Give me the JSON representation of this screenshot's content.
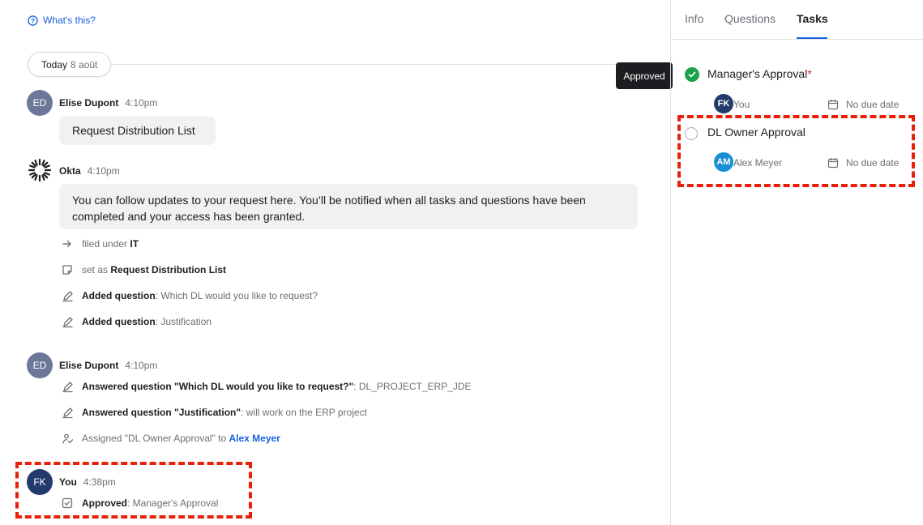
{
  "help": {
    "whats_this": "What's this?"
  },
  "timeline": {
    "day_label": "Today",
    "day_date": "8 août"
  },
  "tooltip": {
    "text": "Approved"
  },
  "messages": [
    {
      "avatar": "ED",
      "name": "Elise Dupont",
      "time": "4:10pm",
      "bubble": "Request Distribution List"
    },
    {
      "avatar": "okta-logo",
      "name": "Okta",
      "time": "4:10pm",
      "bubble": "You can follow updates to your request here. You’ll be notified when all tasks and questions have been completed and your access has been granted."
    },
    {
      "avatar": "ED",
      "name": "Elise Dupont",
      "time": "4:10pm"
    },
    {
      "avatar": "FK",
      "name": "You",
      "time": "4:38pm"
    }
  ],
  "events": {
    "filed": {
      "prefix": "filed under ",
      "value": "IT"
    },
    "set_as": {
      "prefix": "set as ",
      "value": "Request Distribution List"
    },
    "q1": {
      "bold": "Added question",
      "rest": ": Which DL would you like to request?"
    },
    "q2": {
      "bold": "Added question",
      "rest": ": Justification"
    },
    "a1": {
      "bold": "Answered question \"Which DL would you like to request?\"",
      "rest": ": DL_PROJECT_ERP_JDE"
    },
    "a2": {
      "bold": "Answered question \"Justification\"",
      "rest": ": will work on the ERP project"
    },
    "assigned": {
      "prefix": "Assigned \"DL Owner Approval\" to ",
      "link": "Alex Meyer"
    },
    "approved": {
      "bold": "Approved",
      "rest": ": Manager's Approval"
    }
  },
  "panel": {
    "tabs": [
      "Info",
      "Questions",
      "Tasks"
    ],
    "active_tab": "Tasks",
    "tasks": [
      {
        "title": "Manager's Approval",
        "required_mark": "*",
        "status": "done",
        "assignee_initials": "FK",
        "assignee": "You",
        "due": "No due date"
      },
      {
        "title": "DL Owner Approval",
        "status": "pending",
        "assignee_initials": "AM",
        "assignee": "Alex Meyer",
        "due": "No due date"
      }
    ]
  },
  "colors": {
    "accent": "#1662dd",
    "success": "#1aa34a",
    "highlight": "#e8200a"
  }
}
